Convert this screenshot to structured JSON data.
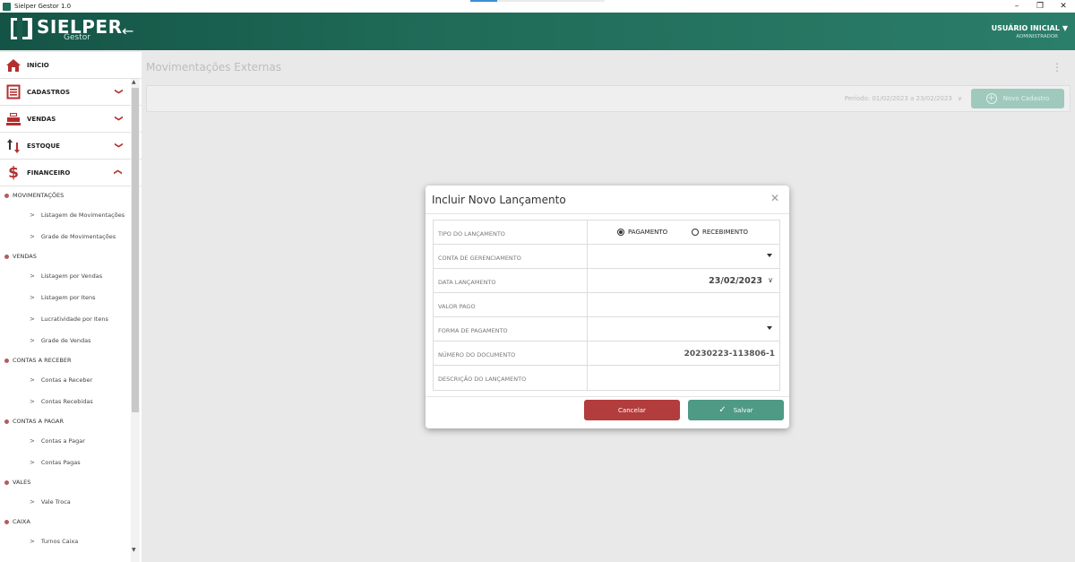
{
  "window": {
    "title": "Sielper Gestor 1.0",
    "controls": {
      "minimize": "–",
      "restore": "❐",
      "close": "✕"
    }
  },
  "header": {
    "brand": "SIELPER",
    "brand_sub": "Gestor",
    "back_icon": "arrow-left-icon",
    "user_name": "USUÁRIO INICIAL",
    "user_role": "ADMINISTRADOR"
  },
  "sidebar": {
    "main_items": [
      {
        "label": "INÍCIO",
        "icon": "home-icon"
      },
      {
        "label": "CADASTROS",
        "icon": "document-icon"
      },
      {
        "label": "VENDAS",
        "icon": "cash-register-icon"
      },
      {
        "label": "ESTOQUE",
        "icon": "sort-arrows-icon"
      },
      {
        "label": "FINANCEIRO",
        "icon": "dollar-icon"
      }
    ],
    "sections": [
      {
        "label": "MOVIMENTAÇÕES",
        "items": [
          "Listagem de Movimentações",
          "Grade de Movimentações"
        ]
      },
      {
        "label": "VENDAS",
        "items": [
          "Listagem por Vendas",
          "Listagem por Itens",
          "Lucratividade por Itens",
          "Grade de Vendas"
        ]
      },
      {
        "label": "CONTAS A RECEBER",
        "items": [
          "Contas a Receber",
          "Contas Recebidas"
        ]
      },
      {
        "label": "CONTAS A PAGAR",
        "items": [
          "Contas a Pagar",
          "Contas Pagas"
        ]
      },
      {
        "label": "VALES",
        "items": [
          "Vale Troca"
        ]
      },
      {
        "label": "CAIXA",
        "items": [
          "Turnos Caixa"
        ]
      }
    ]
  },
  "main": {
    "title": "Movimentações Externas",
    "periodo": "Período: 01/02/2023 a 23/02/2023",
    "novo_cadastro": "Novo Cadastro"
  },
  "modal": {
    "title": "Incluir Novo Lançamento",
    "fields": {
      "tipo_label": "TIPO DO LANÇAMENTO",
      "tipo_options": [
        "PAGAMENTO",
        "RECEBIMENTO"
      ],
      "tipo_selected": "PAGAMENTO",
      "conta_label": "CONTA DE GERENCIAMENTO",
      "conta_value": "",
      "data_label": "DATA LANÇAMENTO",
      "data_value": "23/02/2023",
      "valor_label": "VALOR PAGO",
      "valor_value": "",
      "forma_label": "FORMA DE PAGAMENTO",
      "forma_value": "",
      "numero_label": "NÚMERO DO DOCUMENTO",
      "numero_value": "20230223-113806-1",
      "descricao_label": "DESCRIÇÃO DO LANÇAMENTO",
      "descricao_value": ""
    },
    "cancel_label": "Cancelar",
    "save_label": "Salvar"
  },
  "colors": {
    "header_green": "#1f6b58",
    "accent_red": "#b33c3c",
    "save_green": "#4e9a85"
  }
}
